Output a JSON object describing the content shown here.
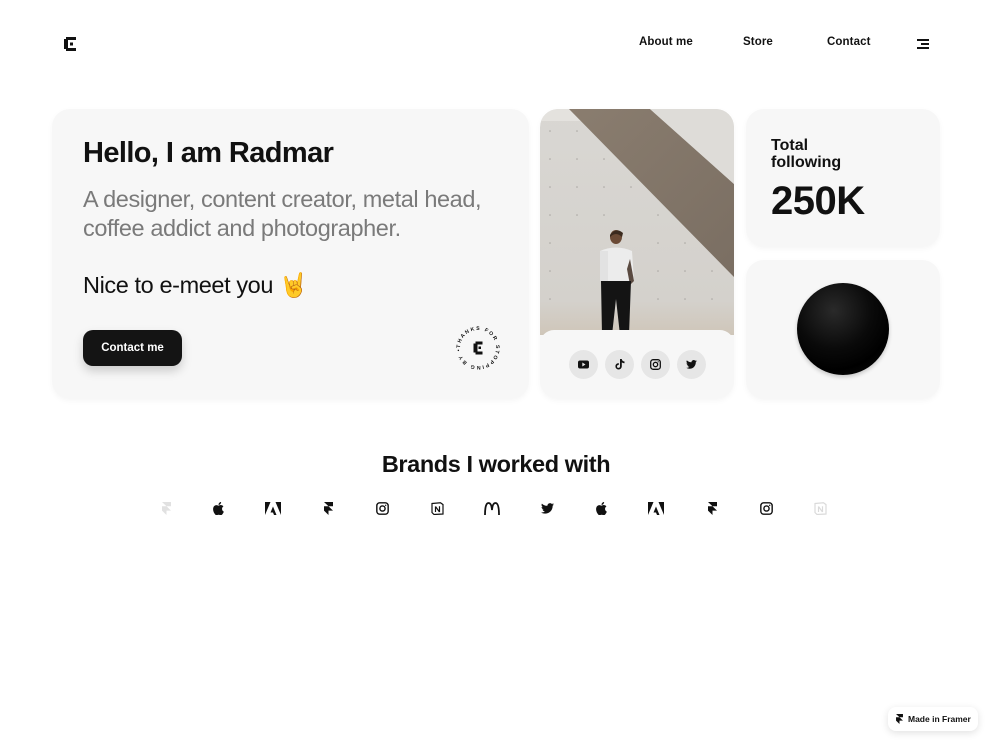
{
  "header": {
    "logo": "logo-icon",
    "nav": [
      {
        "label": "About me"
      },
      {
        "label": "Store"
      },
      {
        "label": "Contact"
      }
    ],
    "menu_icon": "menu-icon"
  },
  "hero": {
    "title": "Hello, I am Radmar",
    "subtitle": "A designer, content creator, metal head, coffee addict and photographer.",
    "greeting": "Nice to e-meet you 🤘",
    "cta_label": "Contact me",
    "badge_text": "THANKS FOR STOPPING BY •"
  },
  "social": [
    {
      "name": "youtube",
      "icon": "youtube-icon"
    },
    {
      "name": "tiktok",
      "icon": "tiktok-icon"
    },
    {
      "name": "instagram",
      "icon": "instagram-icon"
    },
    {
      "name": "twitter",
      "icon": "twitter-icon"
    }
  ],
  "stats": {
    "label": "Total following",
    "value": "250K"
  },
  "brands": {
    "title": "Brands I worked with",
    "items": [
      "framer",
      "apple",
      "adobe",
      "framer",
      "instagram",
      "notion",
      "mcdonalds",
      "twitter",
      "apple",
      "adobe",
      "framer",
      "instagram",
      "notion"
    ]
  },
  "framer_badge": {
    "label": "Made in Framer"
  },
  "colors": {
    "card_bg": "#f7f7f7",
    "text_primary": "#111111",
    "text_muted": "#7a7a7a",
    "button_bg": "#141414",
    "social_btn_bg": "#e6e6e6"
  }
}
